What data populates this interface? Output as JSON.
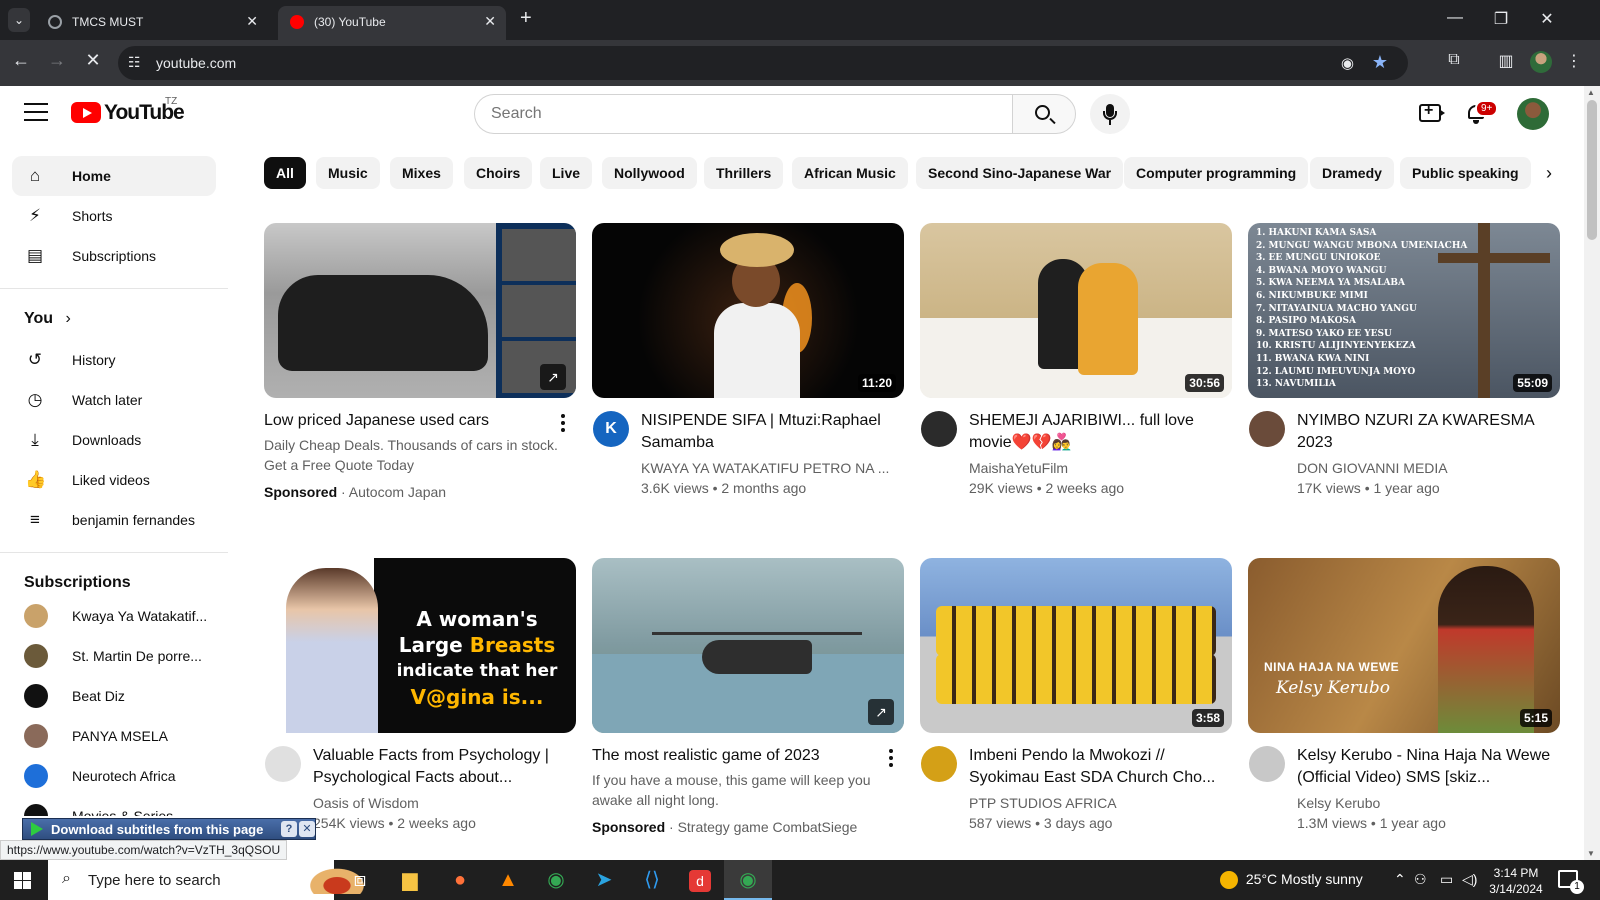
{
  "browser": {
    "tabs": [
      {
        "title": "TMCS MUST",
        "active": false
      },
      {
        "title": "(30) YouTube",
        "active": true
      }
    ],
    "new_tab": "+",
    "url": "youtube.com",
    "window_controls": {
      "minimize": "—",
      "restore": "❐",
      "close": "✕"
    }
  },
  "youtube": {
    "logo_text": "YouTube",
    "country_code": "TZ",
    "search_placeholder": "Search",
    "notification_count": "9+"
  },
  "sidebar": {
    "main": [
      {
        "label": "Home",
        "icon": "home-icon",
        "glyph": "⌂",
        "active": true
      },
      {
        "label": "Shorts",
        "icon": "shorts-icon",
        "glyph": "⚡"
      },
      {
        "label": "Subscriptions",
        "icon": "subscriptions-icon",
        "glyph": "▤"
      }
    ],
    "you_heading": "You",
    "you_chevron": "›",
    "you_items": [
      {
        "label": "History",
        "icon": "history-icon",
        "glyph": "↺"
      },
      {
        "label": "Watch later",
        "icon": "clock-icon",
        "glyph": "◷"
      },
      {
        "label": "Downloads",
        "icon": "download-icon",
        "glyph": "⤓"
      },
      {
        "label": "Liked videos",
        "icon": "thumbs-up-icon",
        "glyph": "👍"
      },
      {
        "label": "benjamin fernandes",
        "icon": "playlist-icon",
        "glyph": "≡"
      }
    ],
    "subscriptions_heading": "Subscriptions",
    "subscriptions": [
      {
        "label": "Kwaya Ya Watakatif...",
        "color": "#c9a26a"
      },
      {
        "label": "St. Martin De porre...",
        "color": "#6b5a3a"
      },
      {
        "label": "Beat Diz",
        "color": "#111111"
      },
      {
        "label": "PANYA MSELA",
        "color": "#8a6a5a"
      },
      {
        "label": "Neurotech Africa",
        "color": "#1e6fd9"
      },
      {
        "label": "Movies & Series",
        "color": "#111111"
      }
    ]
  },
  "chips": [
    "All",
    "Music",
    "Mixes",
    "Choirs",
    "Live",
    "Nollywood",
    "Thrillers",
    "African Music",
    "Second Sino-Japanese War",
    "Computer programming",
    "Dramedy",
    "Public speaking"
  ],
  "videos": [
    {
      "title": "Low priced Japanese used cars",
      "description": "Daily Cheap Deals. Thousands of cars in stock. Get a Free Quote Today",
      "sponsored_label": "Sponsored",
      "advertiser": "Autocom Japan",
      "sponsored": true
    },
    {
      "title": "NISIPENDE SIFA | Mtuzi:Raphael Samamba",
      "channel": "KWAYA YA WATAKATIFU PETRO NA ...",
      "stats": "3.6K views • 2 months ago",
      "duration": "11:20",
      "channel_initial": "K",
      "channel_color": "#1565c0"
    },
    {
      "title": "SHEMEJI AJARIBIWI... full love movie❤️💔👩‍❤️‍👨",
      "channel": "MaishaYetuFilm",
      "stats": "29K views • 2 weeks ago",
      "duration": "30:56",
      "channel_color": "#2b2b2b"
    },
    {
      "title": "NYIMBO NZURI ZA KWARESMA 2023",
      "channel": "DON GIOVANNI MEDIA",
      "stats": "17K views • 1 year ago",
      "duration": "55:09",
      "channel_color": "#6a4b3a",
      "thumb_lines": [
        "1. HAKUNI KAMA SASA",
        "2. MUNGU WANGU MBONA UMENIACHA",
        "3. EE MUNGU UNIOKOE",
        "4. BWANA MOYO WANGU",
        "5. KWA NEEMA YA MSALABA",
        "6. NIKUMBUKE MIMI",
        "7. NITAYAINUA MACHO YANGU",
        "8. PASIPO MAKOSA",
        "9. MATESO YAKO EE YESU",
        "10. KRISTU ALIJINYENYEKEZA",
        "11. BWANA KWA NINI",
        "12. LAUMU IMEUVUNJA MOYO",
        "13. NAVUMILIA"
      ]
    },
    {
      "title": "Valuable Facts from Psychology | Psychological Facts about...",
      "channel": "Oasis of Wisdom",
      "stats": "254K views • 2 weeks ago",
      "channel_color": "#e0e0e0",
      "thumb_text_a": "A woman's",
      "thumb_text_b": "Large",
      "thumb_text_c": "Breasts",
      "thumb_text_d": "indicate that her",
      "thumb_text_e": "V@gina is..."
    },
    {
      "title": "The most realistic game of 2023",
      "description": "If you have a mouse, this game will keep you awake all night long.",
      "sponsored_label": "Sponsored",
      "advertiser": "Strategy game CombatSiege",
      "sponsored": true
    },
    {
      "title": "Imbeni Pendo la Mwokozi // Syokimau East SDA Church Cho...",
      "channel": "PTP STUDIOS AFRICA",
      "stats": "587 views • 3 days ago",
      "duration": "3:58",
      "channel_color": "#d4a017"
    },
    {
      "title": "Kelsy Kerubo - Nina Haja Na Wewe (Official Video) SMS [skiz...",
      "channel": "Kelsy Kerubo",
      "stats": "1.3M views • 1 year ago",
      "duration": "5:15",
      "channel_color": "#c8c8c8",
      "thumb_title": "NINA HAJA NA WEWE",
      "thumb_sig": "Kelsy Kerubo"
    }
  ],
  "overlays": {
    "subtitles_label": "Download subtitles from this page",
    "subtitles_help": "?",
    "subtitles_close": "✕",
    "status_url": "https://www.youtube.com/watch?v=VzTH_3qQSOU"
  },
  "taskbar": {
    "search_placeholder": "Type here to search",
    "weather": "25°C  Mostly sunny",
    "time": "3:14 PM",
    "date": "3/14/2024",
    "notifications": "1"
  }
}
